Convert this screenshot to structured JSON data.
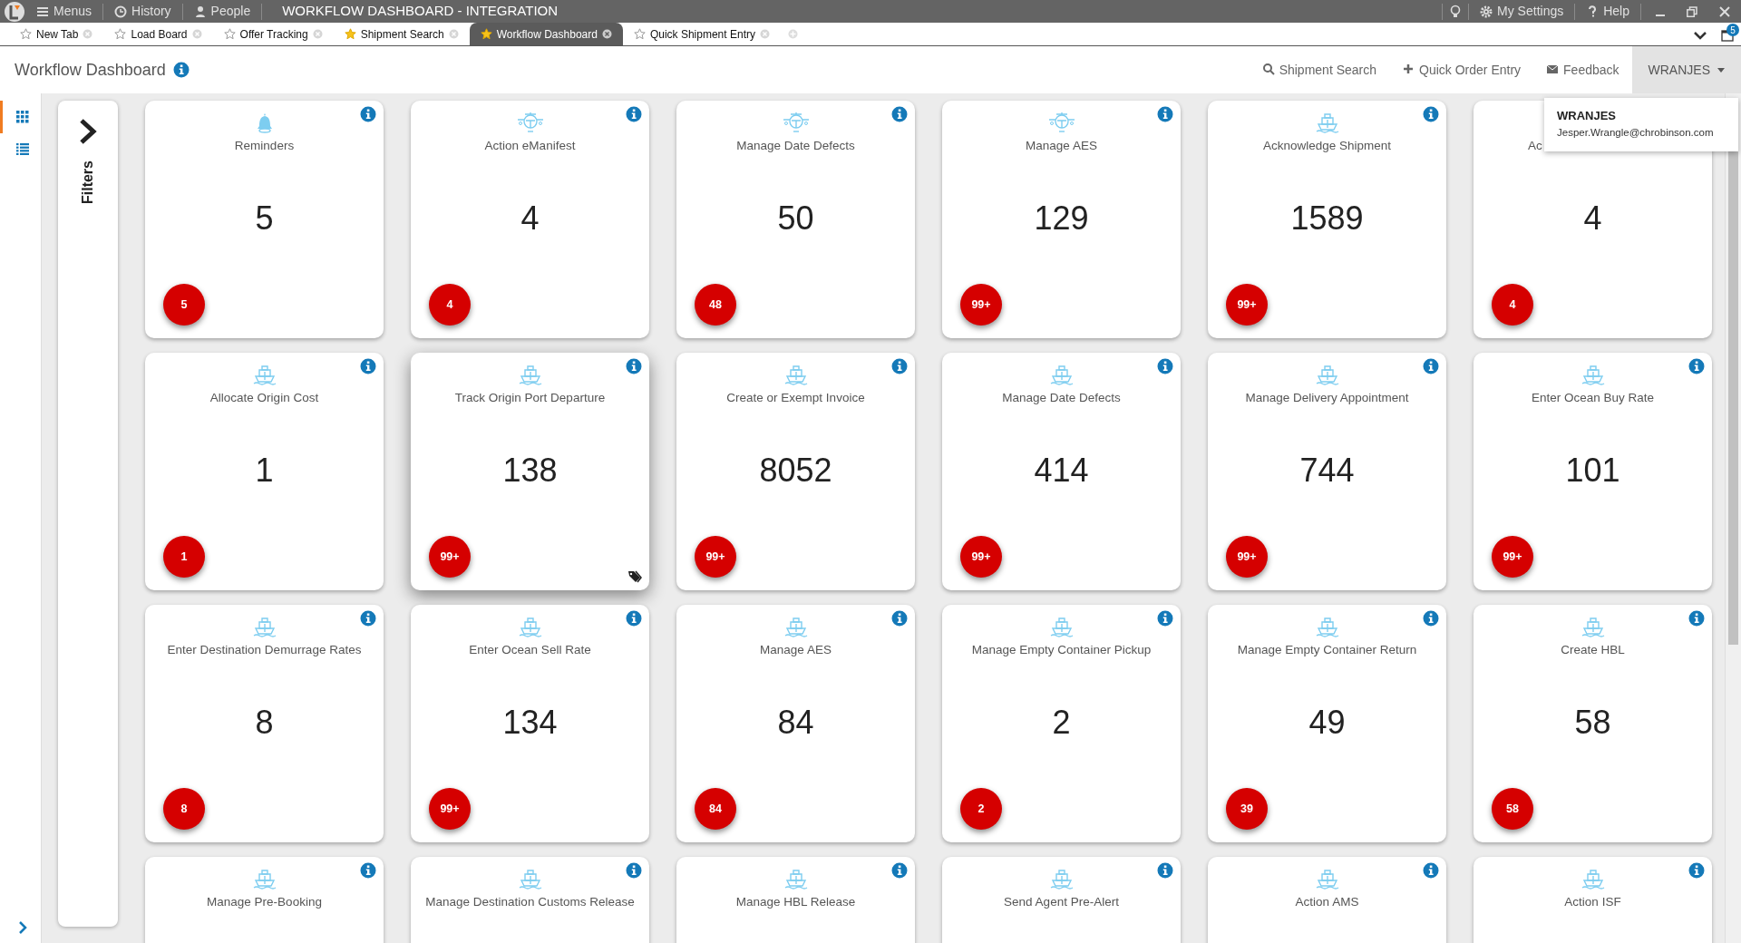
{
  "title_bar": {
    "menu_items": [
      {
        "label": "Menus",
        "kind": "menu"
      },
      {
        "label": "History",
        "kind": "clock"
      },
      {
        "label": "People",
        "kind": "person"
      }
    ],
    "title": "WORKFLOW DASHBOARD - INTEGRATION",
    "right_items": [
      {
        "label": "My Settings",
        "kind": "gear"
      },
      {
        "label": "Help",
        "kind": "help"
      }
    ]
  },
  "tabs": [
    {
      "label": "New Tab",
      "starred": false,
      "selected": false
    },
    {
      "label": "Load Board",
      "starred": false,
      "selected": false
    },
    {
      "label": "Offer Tracking",
      "starred": false,
      "selected": false
    },
    {
      "label": "Shipment Search",
      "starred": true,
      "selected": false
    },
    {
      "label": "Workflow Dashboard",
      "starred": true,
      "selected": true
    },
    {
      "label": "Quick Shipment Entry",
      "starred": false,
      "selected": false
    }
  ],
  "tab_count": "5",
  "header": {
    "title": "Workflow Dashboard",
    "actions": [
      {
        "label": "Shipment Search",
        "kind": "search"
      },
      {
        "label": "Quick Order Entry",
        "kind": "plus"
      },
      {
        "label": "Feedback",
        "kind": "mail"
      }
    ],
    "user": "WRANJES"
  },
  "user_popup": {
    "name": "WRANJES",
    "email": "Jesper.Wrangle@chrobinson.com"
  },
  "sidebar": {
    "views": [
      {
        "kind": "grid",
        "selected": true
      },
      {
        "kind": "list",
        "selected": false
      }
    ]
  },
  "filters": {
    "label": "Filters"
  },
  "tiles": [
    {
      "title": "Reminders",
      "kind": "bell",
      "count": "5",
      "badge": "5",
      "hovered": false
    },
    {
      "title": "Action eManifest",
      "kind": "plane",
      "count": "4",
      "badge": "4",
      "hovered": false
    },
    {
      "title": "Manage Date Defects",
      "kind": "plane",
      "count": "50",
      "badge": "48",
      "hovered": false
    },
    {
      "title": "Manage AES",
      "kind": "plane",
      "count": "129",
      "badge": "99+",
      "hovered": false
    },
    {
      "title": "Acknowledge Shipment",
      "kind": "ship",
      "count": "1589",
      "badge": "99+",
      "hovered": false
    },
    {
      "title": "Ac",
      "partly_hidden": true,
      "count": "4",
      "badge": "4",
      "hovered": false
    },
    {
      "title": "Allocate Origin Cost",
      "kind": "ship",
      "count": "1",
      "badge": "1",
      "hovered": false
    },
    {
      "title": "Track Origin Port Departure",
      "kind": "ship",
      "count": "138",
      "badge": "99+",
      "hovered": true
    },
    {
      "title": "Create or Exempt Invoice",
      "kind": "ship",
      "count": "8052",
      "badge": "99+",
      "hovered": false
    },
    {
      "title": "Manage Date Defects",
      "kind": "ship",
      "count": "414",
      "badge": "99+",
      "hovered": false
    },
    {
      "title": "Manage Delivery Appointment",
      "kind": "ship",
      "count": "744",
      "badge": "99+",
      "hovered": false
    },
    {
      "title": "Enter Ocean Buy Rate",
      "kind": "ship",
      "count": "101",
      "badge": "99+",
      "hovered": false
    },
    {
      "title": "Enter Destination Demurrage Rates",
      "kind": "ship",
      "count": "8",
      "badge": "8",
      "hovered": false
    },
    {
      "title": "Enter Ocean Sell Rate",
      "kind": "ship",
      "count": "134",
      "badge": "99+",
      "hovered": false
    },
    {
      "title": "Manage AES",
      "kind": "ship",
      "count": "84",
      "badge": "84",
      "hovered": false
    },
    {
      "title": "Manage Empty Container Pickup",
      "kind": "ship",
      "count": "2",
      "badge": "2",
      "hovered": false
    },
    {
      "title": "Manage Empty Container Return",
      "kind": "ship",
      "count": "49",
      "badge": "39",
      "hovered": false
    },
    {
      "title": "Create HBL",
      "kind": "ship",
      "count": "58",
      "badge": "58",
      "hovered": false
    },
    {
      "title": "Manage Pre-Booking",
      "kind": "ship",
      "hovered": false
    },
    {
      "title": "Manage Destination Customs Release",
      "kind": "ship",
      "hovered": false
    },
    {
      "title": "Manage HBL Release",
      "kind": "ship",
      "hovered": false
    },
    {
      "title": "Send Agent Pre-Alert",
      "kind": "ship",
      "hovered": false
    },
    {
      "title": "Action AMS",
      "kind": "ship",
      "hovered": false
    },
    {
      "title": "Action ISF",
      "kind": "ship",
      "hovered": false
    }
  ]
}
